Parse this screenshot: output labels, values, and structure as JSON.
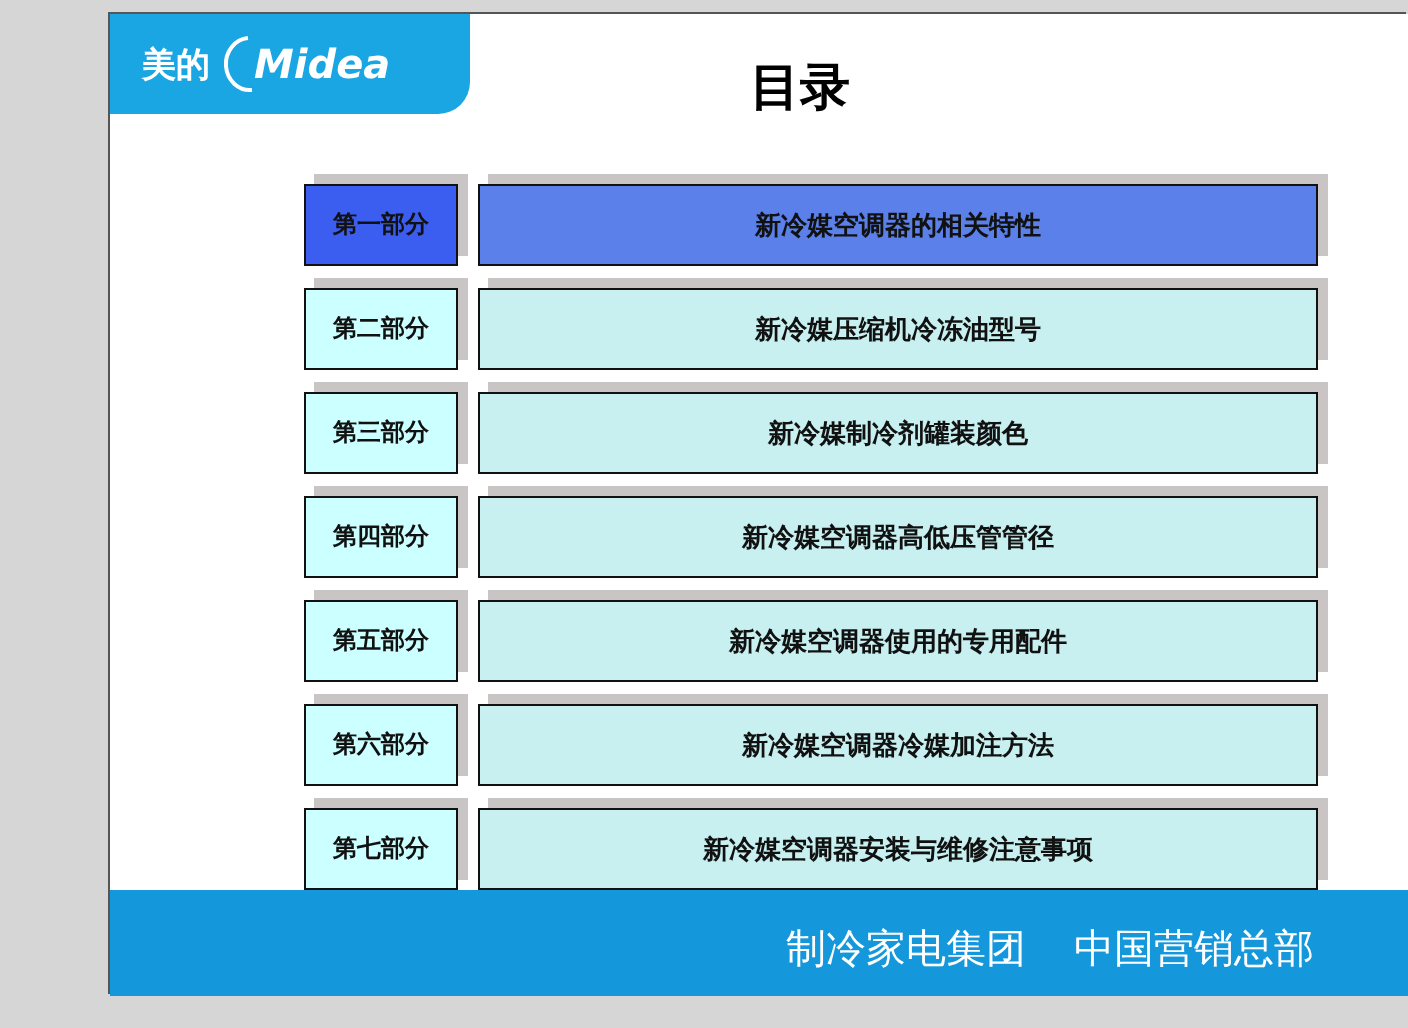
{
  "logo": {
    "brand_cn": "美的",
    "brand": "Midea"
  },
  "title": "目录",
  "sections": [
    {
      "part": "第一部分",
      "title": "新冷媒空调器的相关特性",
      "selected": true
    },
    {
      "part": "第二部分",
      "title": "新冷媒压缩机冷冻油型号",
      "selected": false
    },
    {
      "part": "第三部分",
      "title": "新冷媒制冷剂罐装颜色",
      "selected": false
    },
    {
      "part": "第四部分",
      "title": "新冷媒空调器高低压管管径",
      "selected": false
    },
    {
      "part": "第五部分",
      "title": "新冷媒空调器使用的专用配件",
      "selected": false
    },
    {
      "part": "第六部分",
      "title": "新冷媒空调器冷媒加注方法",
      "selected": false
    },
    {
      "part": "第七部分",
      "title": "新冷媒空调器安装与维修注意事项",
      "selected": false
    }
  ],
  "footer": [
    "制冷家电集团",
    "中国营销总部"
  ]
}
